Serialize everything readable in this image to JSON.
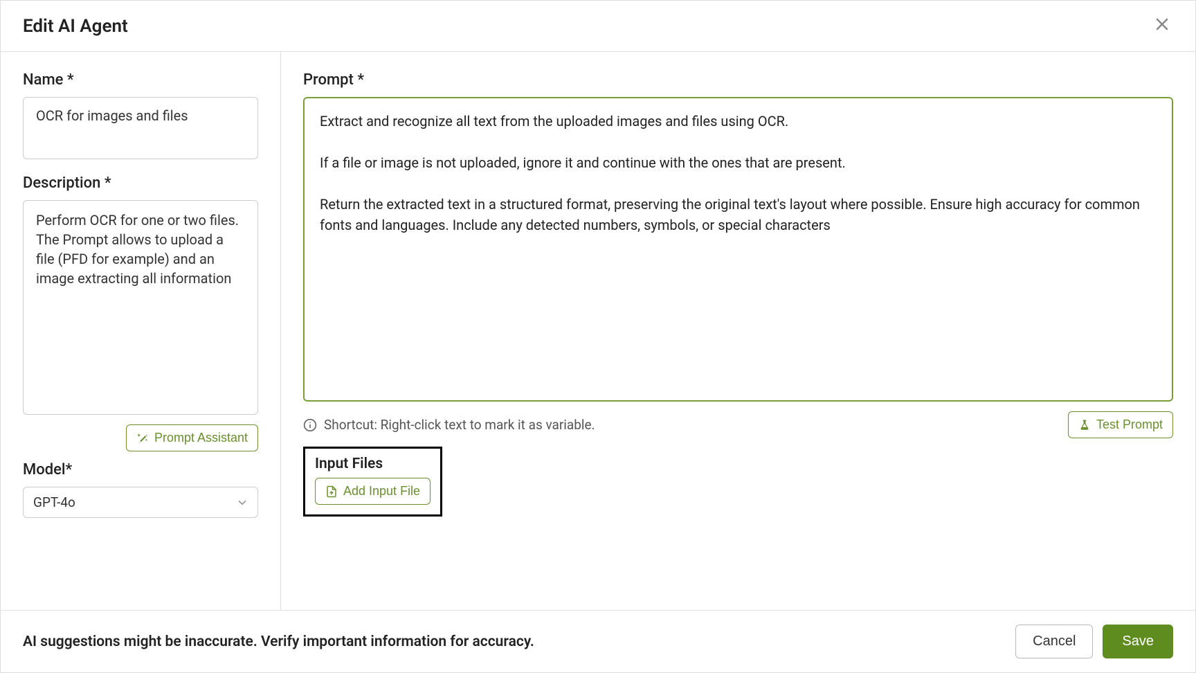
{
  "header": {
    "title": "Edit AI Agent"
  },
  "left": {
    "name_label": "Name *",
    "name_value": "OCR for images and files",
    "desc_label": "Description *",
    "desc_value": "Perform OCR for one or two files. The Prompt allows to upload a file (PFD for example) and an image extracting all information",
    "prompt_assistant_label": "Prompt Assistant",
    "model_label": "Model*",
    "model_value": "GPT-4o"
  },
  "right": {
    "prompt_label": "Prompt *",
    "prompt_value": "Extract and recognize all text from the uploaded images and files using OCR.\n\nIf a file or image is not uploaded, ignore it and continue with the ones that are present.\n\nReturn the extracted text in a structured format, preserving the original text's layout where possible. Ensure high accuracy for common fonts and languages. Include any detected numbers, symbols, or special characters",
    "shortcut_text": "Shortcut: Right-click text to mark it as variable.",
    "test_prompt_label": "Test Prompt",
    "input_files_title": "Input Files",
    "add_input_file_label": "Add Input File"
  },
  "footer": {
    "warning": "AI suggestions might be inaccurate. Verify important information for accuracy.",
    "cancel_label": "Cancel",
    "save_label": "Save"
  }
}
